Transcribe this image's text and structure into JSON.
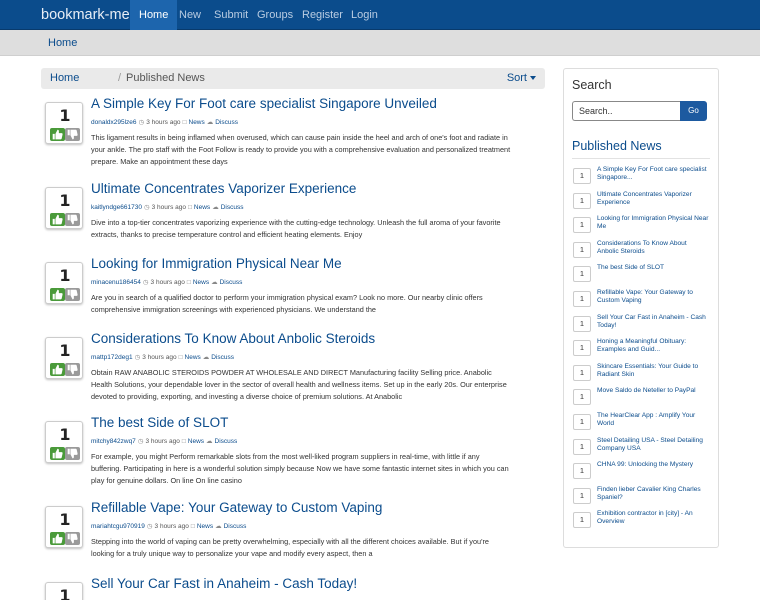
{
  "navbar": {
    "brand": "bookmark-media",
    "items": [
      "Home",
      "New",
      "Submit",
      "Groups",
      "Register",
      "Login"
    ]
  },
  "subbar": {
    "home": "Home"
  },
  "breadcrumb": {
    "home": "Home",
    "current": "Published News",
    "sort": "Sort"
  },
  "stories": [
    {
      "votes": "1",
      "title": "A Simple Key For Foot care specialist Singapore Unveiled",
      "user": "donaldx295lze6",
      "time": "3 hours ago",
      "category": "News",
      "discuss": "Discuss",
      "description": "This ligament results in being inflamed when overused, which can cause pain inside the heel and arch of one's foot and radiate in your ankle. The pro staff with the Foot Follow is ready to provide you with a comprehensive evaluation and personalized treatment prepare. Make an appointment these days"
    },
    {
      "votes": "1",
      "title": "Ultimate Concentrates Vaporizer Experience",
      "user": "kaitlyndge661730",
      "time": "3 hours ago",
      "category": "News",
      "discuss": "Discuss",
      "description": "Dive into a top-tier concentrates vaporizing experience with the cutting-edge technology. Unleash the full aroma of your favorite extracts, thanks to precise temperature control and efficient heating elements. Enjoy"
    },
    {
      "votes": "1",
      "title": "Looking for Immigration Physical Near Me",
      "user": "minacenu186454",
      "time": "3 hours ago",
      "category": "News",
      "discuss": "Discuss",
      "description": "Are you in search of a qualified doctor to perform your immigration physical exam? Look no more. Our nearby clinic offers comprehensive immigration screenings with experienced physicians. We understand the"
    },
    {
      "votes": "1",
      "title": "Considerations To Know About Anbolic Steroids",
      "user": "mattp172deg1",
      "time": "3 hours ago",
      "category": "News",
      "discuss": "Discuss",
      "description": "Obtain RAW ANABOLIC STEROIDS POWDER AT WHOLESALE AND DIRECT Manufacturing facility Selling price. Anabolic Health Solutions, your dependable lover in the sector of overall health and wellness items. Set up in the early 20s. Our enterprise devoted to providing, exporting, and investing a diverse choice of premium solutions. At Anabolic"
    },
    {
      "votes": "1",
      "title": "The best Side of SLOT",
      "user": "mitchy842zwq7",
      "time": "3 hours ago",
      "category": "News",
      "discuss": "Discuss",
      "description": "For example, you might Perform remarkable slots from the most well-liked program suppliers in real-time, with little if any buffering. Participating in here is a wonderful solution simply because Now we have some fantastic internet sites in which you can play for genuine dollars. On line On line casino"
    },
    {
      "votes": "1",
      "title": "Refillable Vape: Your Gateway to Custom Vaping",
      "user": "mariahtcgu970919",
      "time": "3 hours ago",
      "category": "News",
      "discuss": "Discuss",
      "description": "Stepping into the world of vaping can be pretty overwhelming, especially with all the different choices available. But if you're looking for a truly unique way to personalize your vape and modify every aspect, then a"
    },
    {
      "votes": "1",
      "title": "Sell Your Car Fast in Anaheim - Cash Today!",
      "user": "",
      "time": "",
      "category": "",
      "discuss": "",
      "description": ""
    }
  ],
  "sidebar": {
    "search_title": "Search",
    "search_placeholder": "Search..",
    "search_button": "Go",
    "published_title": "Published News",
    "items": [
      {
        "votes": "1",
        "text": "A Simple Key For Foot care specialist Singapore..."
      },
      {
        "votes": "1",
        "text": "Ultimate Concentrates Vaporizer Experience"
      },
      {
        "votes": "1",
        "text": "Looking for Immigration Physical Near Me"
      },
      {
        "votes": "1",
        "text": "Considerations To Know About Anbolic Steroids"
      },
      {
        "votes": "1",
        "text": "The best Side of SLOT"
      },
      {
        "votes": "1",
        "text": "Refillable Vape: Your Gateway to Custom Vaping"
      },
      {
        "votes": "1",
        "text": "Sell Your Car Fast in Anaheim - Cash Today!"
      },
      {
        "votes": "1",
        "text": "Honing a Meaningful Obituary: Examples and Guid..."
      },
      {
        "votes": "1",
        "text": "Skincare Essentials: Your Guide to Radiant Skin"
      },
      {
        "votes": "1",
        "text": "Move Saldo de Neteller to PayPal"
      },
      {
        "votes": "1",
        "text": "The HearClear App : Amplify Your World"
      },
      {
        "votes": "1",
        "text": "Steel Detailing USA - Steel Detailing Company USA"
      },
      {
        "votes": "1",
        "text": "CHNA 99: Unlocking the Mystery"
      },
      {
        "votes": "1",
        "text": "Finden lieber Cavalier King Charles Spaniel?"
      },
      {
        "votes": "1",
        "text": "Exhibition contractor in [city] - An Overview"
      }
    ]
  },
  "colors": {
    "navbar": "#0b4c8c",
    "link": "#0b4c8c",
    "upvote": "#4a9a3a",
    "downvote": "#9a9a9a",
    "subbar": "#dedede"
  },
  "icons": [
    "thumbs-up-icon",
    "thumbs-down-icon",
    "clock-icon",
    "folder-icon",
    "comment-icon",
    "caret-down-icon"
  ]
}
